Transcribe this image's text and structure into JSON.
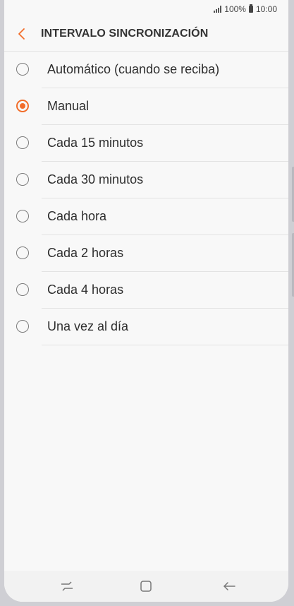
{
  "status_bar": {
    "battery": "100%",
    "time": "10:00"
  },
  "header": {
    "title": "INTERVALO SINCRONIZACIÓN",
    "back_icon": "chevron-left-icon",
    "accent_color": "#f26d2a"
  },
  "options": [
    {
      "label": "Automático (cuando se reciba)",
      "selected": false
    },
    {
      "label": "Manual",
      "selected": true
    },
    {
      "label": "Cada 15 minutos",
      "selected": false
    },
    {
      "label": "Cada 30 minutos",
      "selected": false
    },
    {
      "label": "Cada hora",
      "selected": false
    },
    {
      "label": "Cada 2 horas",
      "selected": false
    },
    {
      "label": "Cada 4 horas",
      "selected": false
    },
    {
      "label": "Una vez al día",
      "selected": false
    }
  ],
  "nav_bar": {
    "recent_icon": "recent-apps-icon",
    "home_icon": "home-icon",
    "back_icon": "back-arrow-icon"
  }
}
